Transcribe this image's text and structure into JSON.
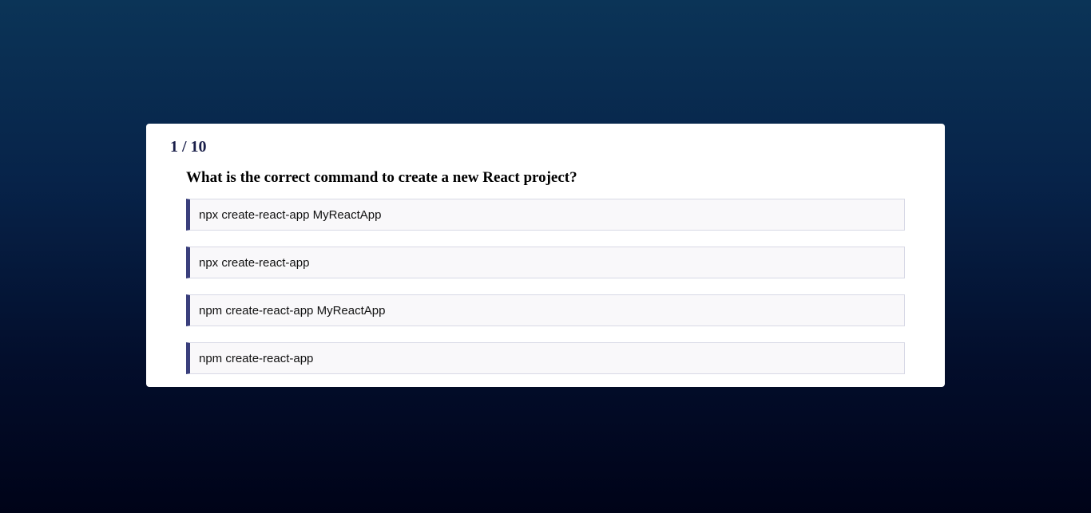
{
  "quiz": {
    "counter": "1 / 10",
    "question": "What is the correct command to create a new React project?",
    "options": [
      {
        "label": "npx create-react-app MyReactApp"
      },
      {
        "label": "npx create-react-app"
      },
      {
        "label": "npm create-react-app MyReactApp"
      },
      {
        "label": "npm create-react-app"
      }
    ]
  },
  "colors": {
    "accent": "#3a3f7c",
    "card_background": "#ffffff",
    "page_background_top": "#0b3457",
    "page_background_bottom": "#000318"
  }
}
